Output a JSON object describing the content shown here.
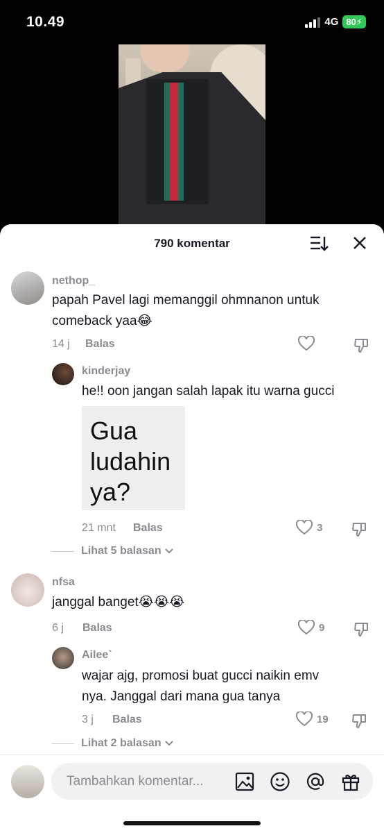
{
  "status": {
    "time": "10.49",
    "network": "4G",
    "battery": "80"
  },
  "sheet": {
    "title": "790 komentar"
  },
  "comments": [
    {
      "username": "nethop_",
      "text": "papah Pavel lagi memanggil ohmnanon untuk\ncomeback yaa😂",
      "time": "14 j",
      "reply_label": "Balas",
      "likes": "",
      "replies": [
        {
          "username": "kinderjay",
          "text": "he!! oon jangan salah lapak itu warna gucci",
          "sticker_text": "Gua\nludahin\nya?",
          "time": "21 mnt",
          "reply_label": "Balas",
          "likes": "3"
        }
      ],
      "view_more": "Lihat 5 balasan"
    },
    {
      "username": "nfsa",
      "text": "janggal banget😭😭😭",
      "time": "6 j",
      "reply_label": "Balas",
      "likes": "9",
      "replies": [
        {
          "username": "Ailee`",
          "text": "wajar ajg, promosi buat gucci naikin emv\nnya. Janggal dari mana gua tanya",
          "time": "3 j",
          "reply_label": "Balas",
          "likes": "19"
        }
      ],
      "view_more": "Lihat 2 balasan"
    }
  ],
  "input": {
    "placeholder": "Tambahkan komentar..."
  },
  "icons": [
    "sort-icon",
    "close-icon",
    "heart-icon",
    "dislike-icon",
    "chevron-down-icon",
    "image-icon",
    "emoji-icon",
    "mention-icon",
    "gift-icon"
  ]
}
